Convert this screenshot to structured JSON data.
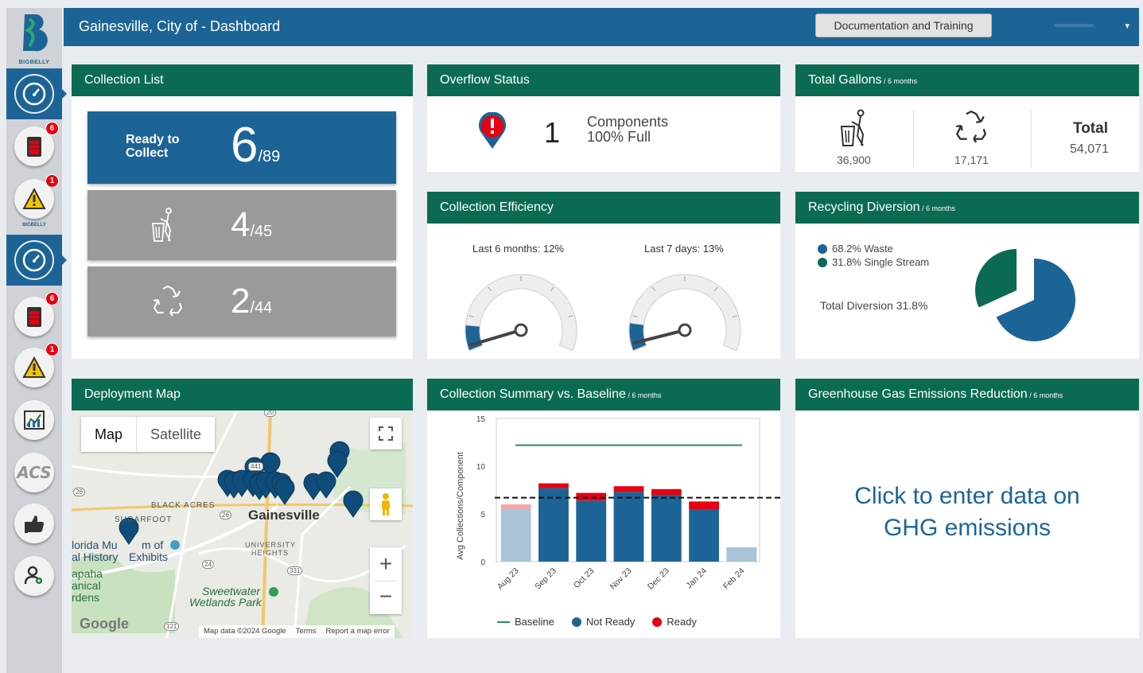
{
  "sidebar": {
    "logo_text": "BIGBELLY",
    "section_label": "BIGBELLY",
    "acs_label": "ACS",
    "badges": {
      "bins": "6",
      "alerts": "1"
    }
  },
  "header": {
    "title": "Gainesville, City of - Dashboard",
    "doc_button": "Documentation and Training",
    "caret": "▾"
  },
  "collection_list": {
    "title": "Collection List",
    "ready_label_1": "Ready to",
    "ready_label_2": "Collect",
    "ready_value": "6",
    "ready_total": "/89",
    "waste_value": "4",
    "waste_total": "/45",
    "recycle_value": "2",
    "recycle_total": "/44"
  },
  "overflow": {
    "title": "Overflow Status",
    "count": "1",
    "label_1": "Components",
    "label_2": "100% Full"
  },
  "gallons": {
    "title": "Total Gallons",
    "subtitle": " / 6 months",
    "waste": "36,900",
    "recycle": "17,171",
    "total_label": "Total",
    "total": "54,071"
  },
  "efficiency": {
    "title": "Collection Efficiency",
    "gauges": [
      {
        "label": "Last 6 months: 12%",
        "value": 12
      },
      {
        "label": "Last 7 days: 13%",
        "value": 13
      }
    ]
  },
  "recycling": {
    "title": "Recycling Diversion",
    "subtitle": " / 6 months",
    "legend_waste": "68.2% Waste",
    "legend_stream": "31.8% Single Stream",
    "total_diversion": "Total Diversion 31.8%",
    "waste_pct": 68.2,
    "stream_pct": 31.8,
    "colors": {
      "waste": "#1d6496",
      "stream": "#0b6b52"
    }
  },
  "map": {
    "title": "Deployment Map",
    "tab_map": "Map",
    "tab_satellite": "Satellite",
    "labels": {
      "black_acres": "BLACK ACRES",
      "sugarfoot": "SUGARFOOT",
      "university": "UNIVERSITY",
      "heights": "HEIGHTS",
      "city": "Gainesville",
      "museum_1": "lorida Mu",
      "museum_2": "m of",
      "museum_3": "al History",
      "museum_4": "Exhibits",
      "kanapaha_1": "apaha",
      "kanapaha_2": "anical",
      "kanapaha_3": "rdens",
      "sweetwater_1": "Sweetwater",
      "sweetwater_2": "Wetlands Park",
      "google": "Google",
      "route_441": "441",
      "route_26a": "26",
      "route_26b": "26",
      "route_24": "24",
      "route_331": "331",
      "route_20": "20",
      "route_121": "121"
    },
    "attribution": {
      "data": "Map data ©2024 Google",
      "terms": "Terms",
      "report": "Report a map error"
    }
  },
  "summary": {
    "title": "Collection Summary vs. Baseline",
    "subtitle": " / 6 months",
    "legend_baseline": "Baseline",
    "legend_not_ready": "Not Ready",
    "legend_ready": "Ready"
  },
  "ghg": {
    "title": "Greenhouse Gas Emissions Reduction",
    "subtitle": " / 6 months",
    "line_1": "Click to enter data on",
    "line_2": "GHG emissions"
  },
  "chart_data": {
    "type": "bar",
    "categories": [
      "Aug 23",
      "Sep 23",
      "Oct 23",
      "Nov 23",
      "Dec 23",
      "Jan 24",
      "Feb 24"
    ],
    "series": [
      {
        "name": "Not Ready",
        "values": [
          5.5,
          7.7,
          6.4,
          7.3,
          7.0,
          5.5,
          1.5
        ],
        "color": "#1d6496"
      },
      {
        "name": "Ready",
        "values": [
          0.5,
          0.5,
          0.8,
          0.6,
          0.6,
          0.8,
          0.0
        ],
        "color": "#e60012"
      }
    ],
    "baseline": {
      "name": "Baseline",
      "value": 12.2,
      "color": "#2e8b6e"
    },
    "average_line": 6.7,
    "ylabel": "Avg Collections/Component",
    "ylim": [
      0,
      15
    ],
    "yticks": [
      0,
      5,
      10,
      15
    ],
    "faded_categories": [
      "Aug 23",
      "Feb 24"
    ]
  }
}
